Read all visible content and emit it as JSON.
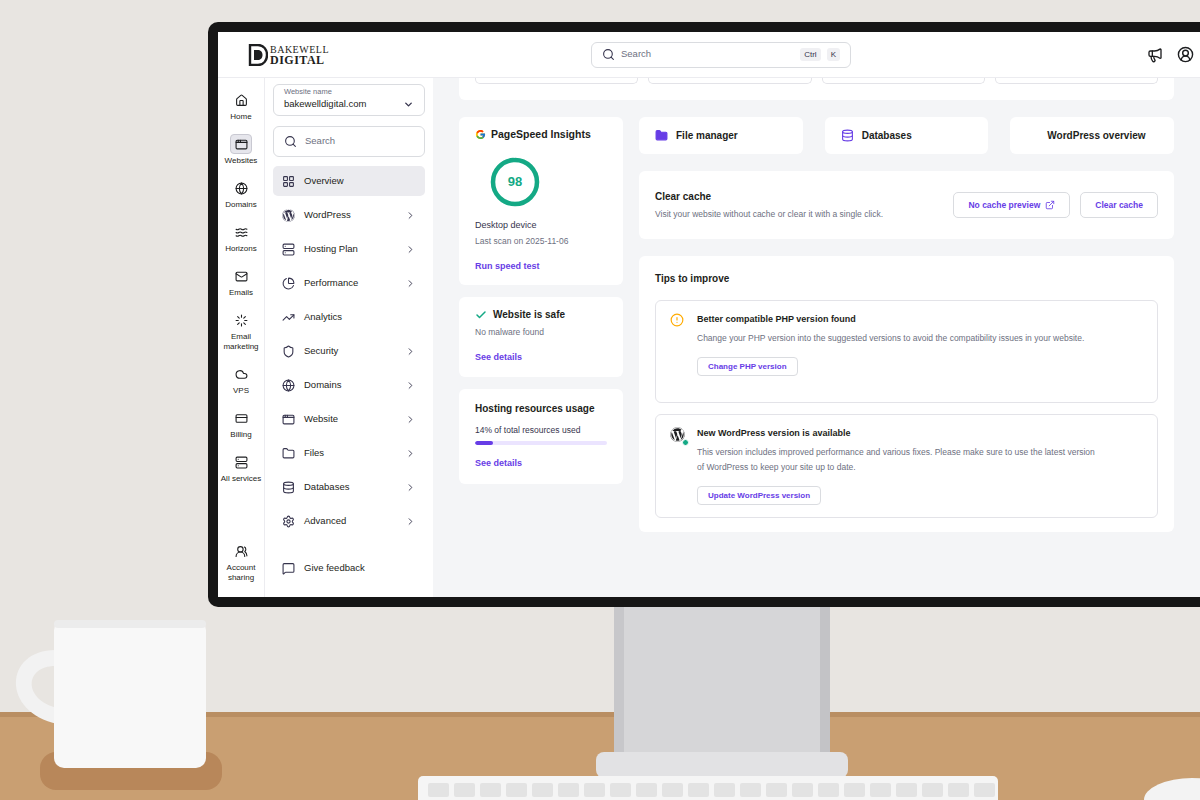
{
  "brand": {
    "line1": "BAKEWELL",
    "line2": "DIGITAL"
  },
  "search": {
    "placeholder": "Search",
    "keys": [
      "Ctrl",
      "K"
    ]
  },
  "rail": [
    {
      "label": "Home",
      "selected": false
    },
    {
      "label": "Websites",
      "selected": true
    },
    {
      "label": "Domains",
      "selected": false
    },
    {
      "label": "Horizons",
      "selected": false
    },
    {
      "label": "Emails",
      "selected": false
    },
    {
      "label": "Email marketing",
      "selected": false
    },
    {
      "label": "VPS",
      "selected": false
    },
    {
      "label": "Billing",
      "selected": false
    },
    {
      "label": "All services",
      "selected": false
    }
  ],
  "rail_bottom": {
    "label": "Account sharing",
    "selected": false
  },
  "website_select": {
    "label": "Website name",
    "value": "bakewelldigital.com"
  },
  "menu_search": {
    "placeholder": "Search"
  },
  "menu": [
    {
      "label": "Overview",
      "selected": true,
      "expandable": false
    },
    {
      "label": "WordPress",
      "selected": false,
      "expandable": true
    },
    {
      "label": "Hosting Plan",
      "selected": false,
      "expandable": true
    },
    {
      "label": "Performance",
      "selected": false,
      "expandable": true
    },
    {
      "label": "Analytics",
      "selected": false,
      "expandable": false
    },
    {
      "label": "Security",
      "selected": false,
      "expandable": true
    },
    {
      "label": "Domains",
      "selected": false,
      "expandable": true
    },
    {
      "label": "Website",
      "selected": false,
      "expandable": true
    },
    {
      "label": "Files",
      "selected": false,
      "expandable": true
    },
    {
      "label": "Databases",
      "selected": false,
      "expandable": true
    },
    {
      "label": "Advanced",
      "selected": false,
      "expandable": true
    }
  ],
  "feedback": "Give feedback",
  "pagespeed": {
    "title": "PageSpeed Insights",
    "score": "98",
    "level": 0.98,
    "device": "Desktop device",
    "last_scan": "Last scan on 2025-11-06",
    "action": "Run speed test"
  },
  "safety": {
    "title": "Website is safe",
    "text": "No malware found",
    "action": "See details"
  },
  "resources": {
    "title": "Hosting resources usage",
    "usage": "14% of total resources used",
    "level": 0.14,
    "action": "See details"
  },
  "shortcuts": [
    "File manager",
    "Databases",
    "WordPress overview"
  ],
  "cache": {
    "title": "Clear cache",
    "text": "Visit your website without cache or clear it with a single click.",
    "preview": "No cache preview",
    "clear": "Clear cache"
  },
  "tips": {
    "title": "Tips to improve",
    "items": [
      {
        "kind": "warning",
        "title": "Better compatible PHP version found",
        "text": "Change your PHP version into the suggested versions to avoid the compatibility issues in your website.",
        "action": "Change PHP version"
      },
      {
        "kind": "update",
        "title": "New WordPress version is available",
        "text": "This version includes improved performance and various fixes. Please make sure to use the latest version of WordPress to keep your site up to date.",
        "action": "Update WordPress version"
      }
    ]
  }
}
